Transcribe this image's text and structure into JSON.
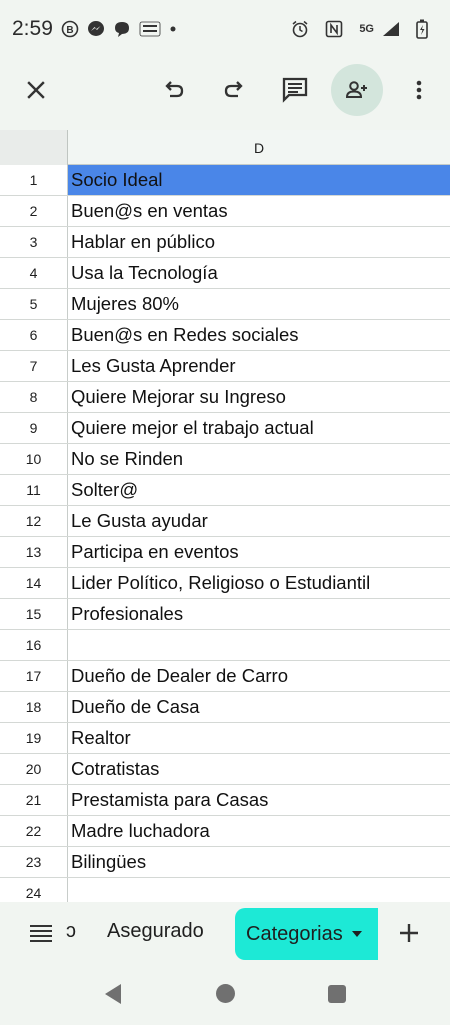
{
  "status_bar": {
    "time": "2:59",
    "network": "5G"
  },
  "toolbar": {
    "close_icon": "close-icon",
    "undo_icon": "undo-icon",
    "redo_icon": "redo-icon",
    "comment_icon": "comment-icon",
    "share_icon": "add-person-icon",
    "more_icon": "more-vert-icon"
  },
  "sheet": {
    "column_header": "D",
    "selected_row": 1,
    "selection_color": "#4a86e8",
    "rows": [
      {
        "num": "1",
        "value": "Socio Ideal"
      },
      {
        "num": "2",
        "value": "Buen@s en ventas"
      },
      {
        "num": "3",
        "value": "Hablar en público"
      },
      {
        "num": "4",
        "value": "Usa la Tecnología"
      },
      {
        "num": "5",
        "value": "Mujeres 80%"
      },
      {
        "num": "6",
        "value": "Buen@s en Redes sociales"
      },
      {
        "num": "7",
        "value": "Les Gusta Aprender"
      },
      {
        "num": "8",
        "value": "Quiere Mejorar su Ingreso"
      },
      {
        "num": "9",
        "value": "Quiere mejor el trabajo actual"
      },
      {
        "num": "10",
        "value": "No se Rinden"
      },
      {
        "num": "11",
        "value": "Solter@"
      },
      {
        "num": "12",
        "value": "Le Gusta ayudar"
      },
      {
        "num": "13",
        "value": "Participa en eventos"
      },
      {
        "num": "14",
        "value": "Lider Político, Religioso o Estudiantil"
      },
      {
        "num": "15",
        "value": "Profesionales"
      },
      {
        "num": "16",
        "value": ""
      },
      {
        "num": "17",
        "value": "Dueño de Dealer de Carro"
      },
      {
        "num": "18",
        "value": "Dueño de Casa"
      },
      {
        "num": "19",
        "value": "Realtor"
      },
      {
        "num": "20",
        "value": "Cotratistas"
      },
      {
        "num": "21",
        "value": "Prestamista para Casas"
      },
      {
        "num": "22",
        "value": "Madre luchadora"
      },
      {
        "num": "23",
        "value": "Bilingües"
      },
      {
        "num": "24",
        "value": ""
      }
    ]
  },
  "sheet_tabs": {
    "partial_tab": "ɔ",
    "tab_1": "Asegurado",
    "tab_active": "Categorias",
    "active_color": "#1de9d6"
  }
}
